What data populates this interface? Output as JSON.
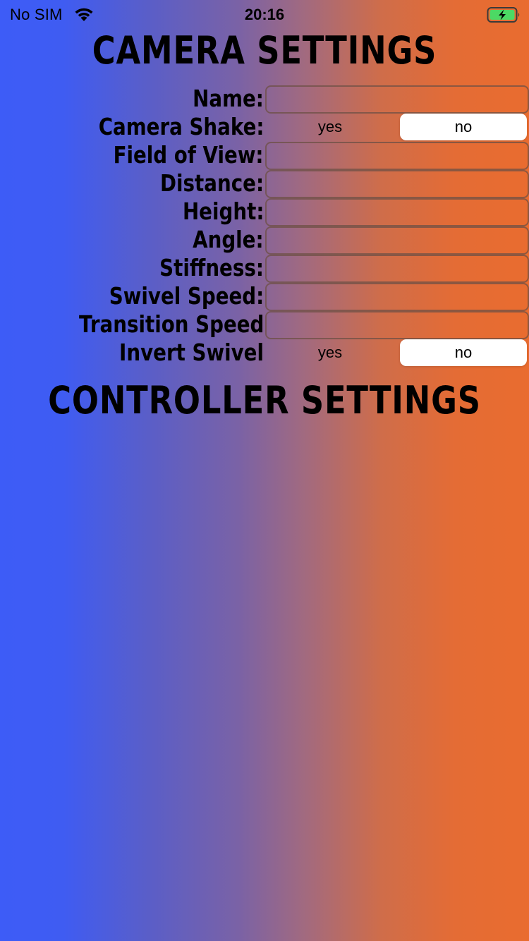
{
  "status_bar": {
    "carrier": "No SIM",
    "time": "20:16",
    "icons": [
      "wifi-icon",
      "battery-charging-icon"
    ]
  },
  "camera_settings": {
    "title": "CAMERA SETTINGS",
    "rows": [
      {
        "label": "Name:",
        "type": "text",
        "value": ""
      },
      {
        "label": "Camera Shake:",
        "type": "segmented",
        "options": [
          "yes",
          "no"
        ],
        "selected": "no"
      },
      {
        "label": "Field of View:",
        "type": "text",
        "value": ""
      },
      {
        "label": "Distance:",
        "type": "text",
        "value": ""
      },
      {
        "label": "Height:",
        "type": "text",
        "value": ""
      },
      {
        "label": "Angle:",
        "type": "text",
        "value": ""
      },
      {
        "label": "Stiffness:",
        "type": "text",
        "value": ""
      },
      {
        "label": "Swivel Speed:",
        "type": "text",
        "value": ""
      },
      {
        "label": "Transition Speed",
        "type": "text",
        "value": ""
      },
      {
        "label": "Invert Swivel",
        "type": "segmented",
        "options": [
          "yes",
          "no"
        ],
        "selected": "no"
      }
    ]
  },
  "controller_settings": {
    "title": "CONTROLLER SETTINGS"
  },
  "colors": {
    "gradient_left": "#3d5cf7",
    "gradient_right": "#e96c2f",
    "field_border": "#6e5046",
    "segment_selected": "#ffffff"
  }
}
